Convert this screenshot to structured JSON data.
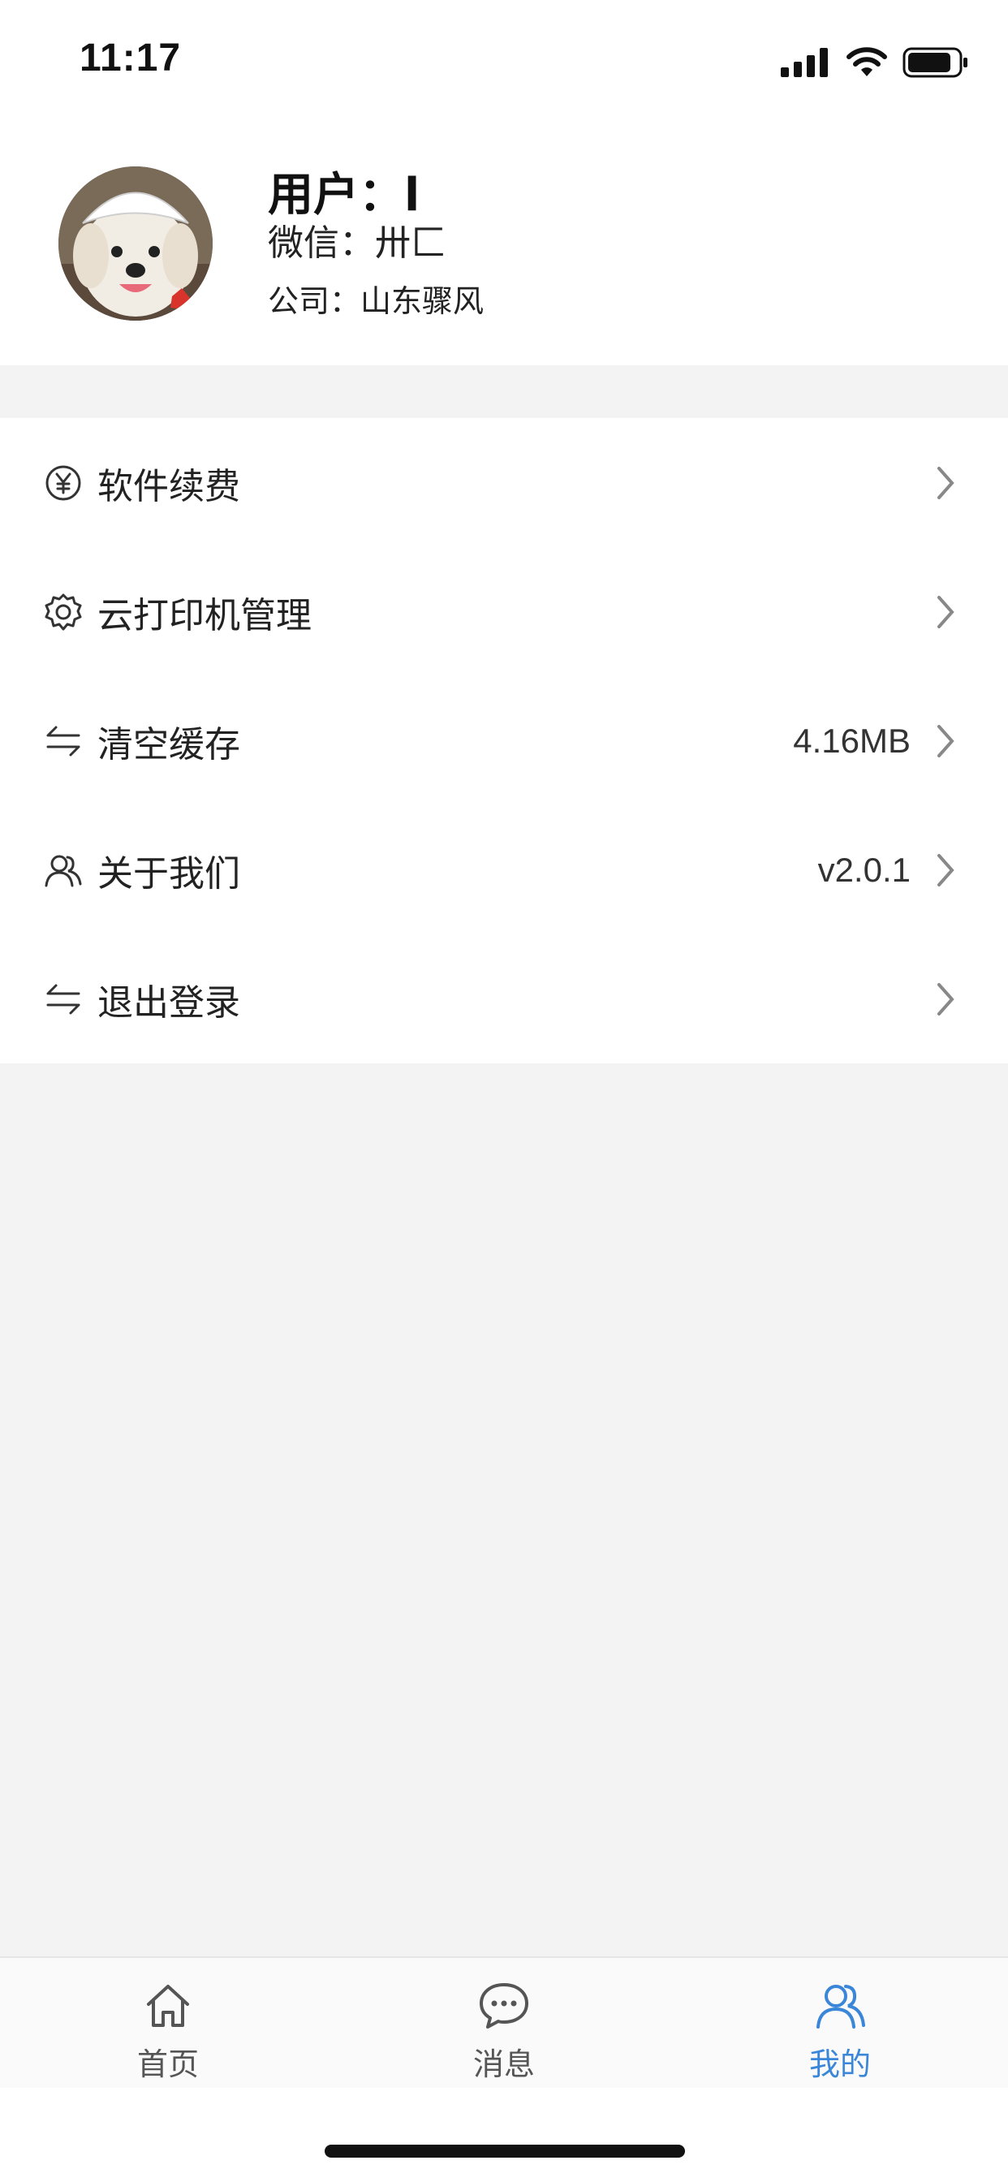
{
  "status_bar": {
    "time": "11:17"
  },
  "profile": {
    "name": "用户：l",
    "wechat": "微信：卅匚",
    "company": "公司：山东骤风"
  },
  "menu": {
    "items": [
      {
        "icon": "yen-circle-icon",
        "label": "软件续费",
        "value": ""
      },
      {
        "icon": "gear-icon",
        "label": "云打印机管理",
        "value": ""
      },
      {
        "icon": "swap-arrows-icon",
        "label": "清空缓存",
        "value": "4.16MB"
      },
      {
        "icon": "users-icon",
        "label": "关于我们",
        "value": "v2.0.1"
      },
      {
        "icon": "swap-arrows-icon",
        "label": "退出登录",
        "value": ""
      }
    ]
  },
  "tab_bar": {
    "tabs": [
      {
        "icon": "home-icon",
        "label": "首页",
        "active": false
      },
      {
        "icon": "chat-bubble-icon",
        "label": "消息",
        "active": false
      },
      {
        "icon": "users-icon",
        "label": "我的",
        "active": true
      }
    ],
    "active_color": "#3a86d8",
    "inactive_color": "#555555"
  }
}
